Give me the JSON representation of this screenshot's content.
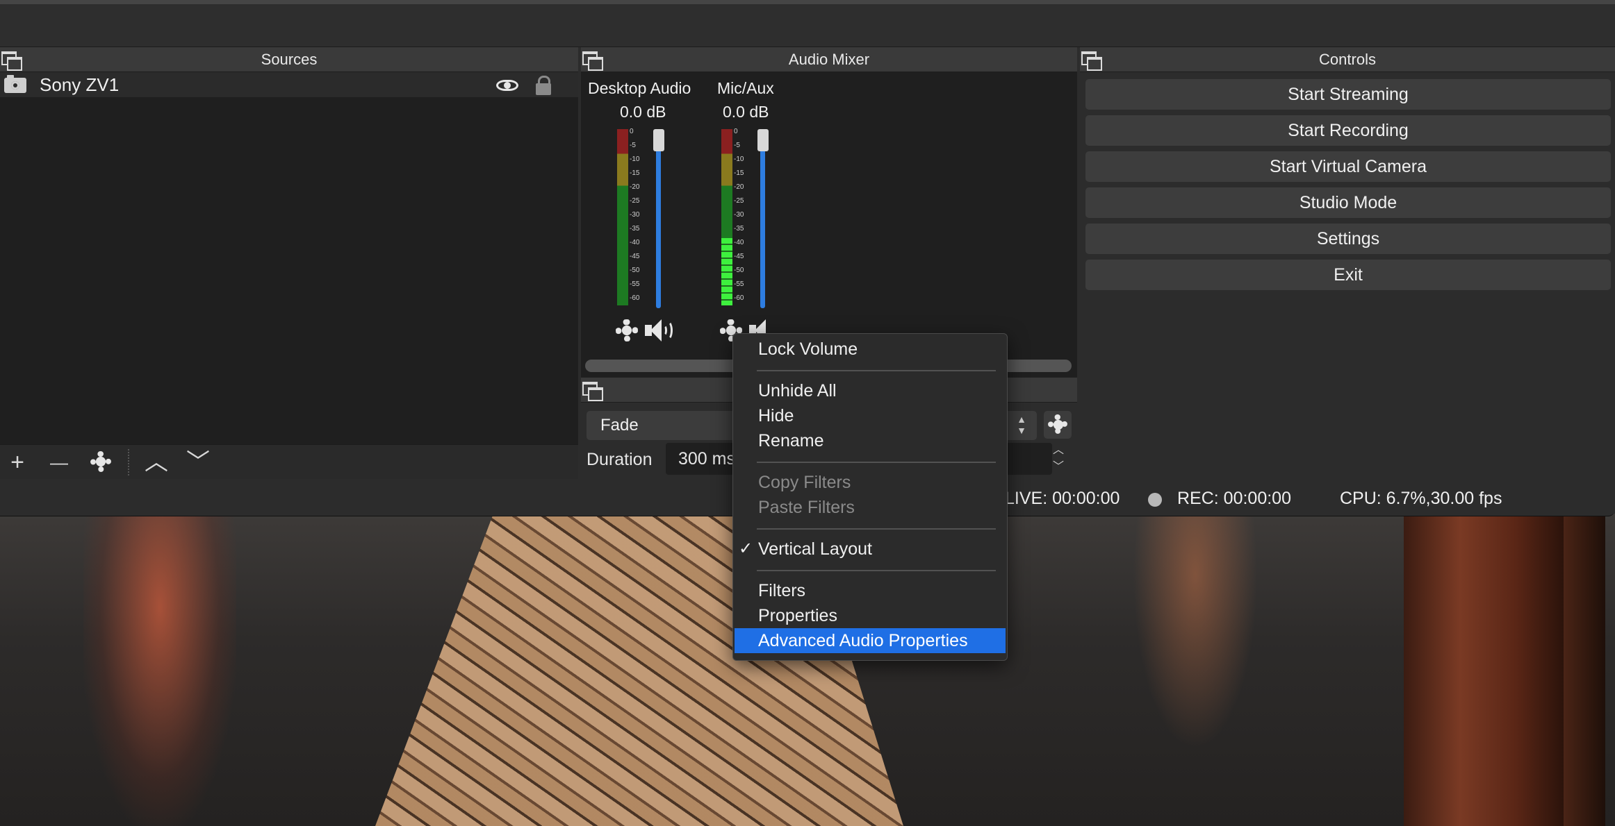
{
  "sources": {
    "title": "Sources",
    "items": [
      {
        "name": "Sony ZV1",
        "visible": true,
        "locked": false
      }
    ],
    "toolbar": {
      "add": "+",
      "remove": "—",
      "up": "︿",
      "down": "﹀"
    }
  },
  "mixer": {
    "title": "Audio Mixer",
    "channels": [
      {
        "name": "Desktop Audio",
        "level": "0.0 dB"
      },
      {
        "name": "Mic/Aux",
        "level": "0.0 dB"
      }
    ],
    "scale": [
      "0",
      "-5",
      "-10",
      "-15",
      "-20",
      "-25",
      "-30",
      "-35",
      "-40",
      "-45",
      "-50",
      "-55",
      "-60"
    ]
  },
  "transitions": {
    "selected": "Fade",
    "duration_label": "Duration",
    "duration_value": "300 ms"
  },
  "controls": {
    "title": "Controls",
    "buttons": [
      "Start Streaming",
      "Start Recording",
      "Start Virtual Camera",
      "Studio Mode",
      "Settings",
      "Exit"
    ]
  },
  "status": {
    "live": "LIVE: 00:00:00",
    "rec": "REC: 00:00:00",
    "cpu": "CPU: 6.7%,30.00 fps"
  },
  "context_menu": {
    "items": {
      "lock_volume": "Lock Volume",
      "unhide_all": "Unhide All",
      "hide": "Hide",
      "rename": "Rename",
      "copy_filters": "Copy Filters",
      "paste_filters": "Paste Filters",
      "vertical_layout": "Vertical Layout",
      "filters": "Filters",
      "properties": "Properties",
      "advanced_audio": "Advanced Audio Properties"
    },
    "check_mark": "✓",
    "highlighted": "Advanced Audio Properties",
    "vertical_layout_checked": true
  },
  "colors": {
    "accent": "#1f6fe5",
    "fader": "#2e7de0"
  }
}
